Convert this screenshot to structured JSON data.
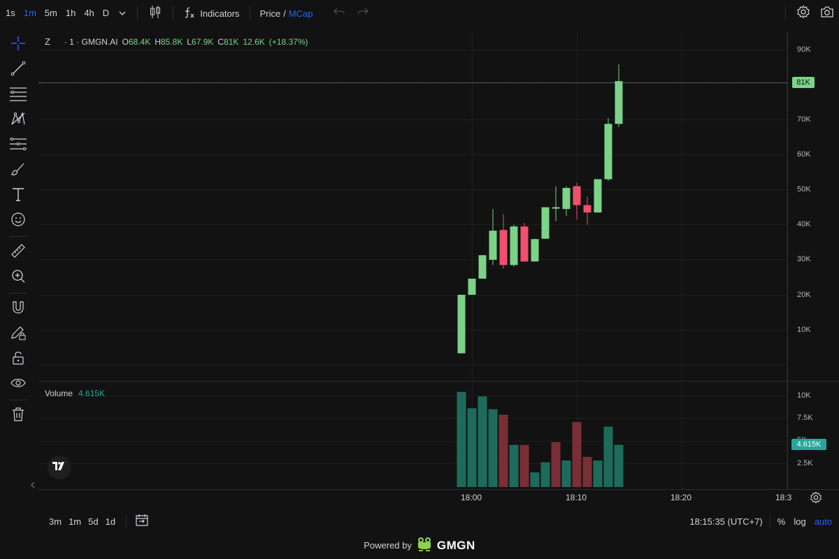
{
  "toolbar": {
    "timeframes": [
      "1s",
      "1m",
      "5m",
      "1h",
      "4h",
      "D"
    ],
    "active_timeframe": "1m",
    "indicators_label": "Indicators",
    "price_label": "Price",
    "price_sep": "/",
    "mcap_label": "MCap"
  },
  "legend": {
    "symbol": "Z",
    "interval": "· 1 · GMGN.AI",
    "open_label": "O",
    "open": "68.4K",
    "high_label": "H",
    "high": "85.8K",
    "low_label": "L",
    "low": "67.9K",
    "close_label": "C",
    "close": "81K",
    "change": "12.6K",
    "change_pct": "(+18.37%)"
  },
  "volume_legend": {
    "label": "Volume",
    "value": "4.615K"
  },
  "price_axis": [
    "90K",
    "70K",
    "60K",
    "50K",
    "40K",
    "30K",
    "20K",
    "10K"
  ],
  "last_price_tag": "81K",
  "volume_axis": [
    "10K",
    "7.5K",
    "5K",
    "2.5K"
  ],
  "last_volume_tag": "4.615K",
  "time_axis": [
    "18:00",
    "18:10",
    "18:20",
    "18:3"
  ],
  "bottom": {
    "ranges": [
      "3m",
      "1m",
      "5d",
      "1d"
    ],
    "clock": "18:15:35 (UTC+7)",
    "percent": "%",
    "log": "log",
    "auto": "auto"
  },
  "footer": {
    "powered_by": "Powered by",
    "brand": "GMGN"
  },
  "colors": {
    "up": "#7bd389",
    "down": "#f0506e",
    "vol_up": "#1e6b5c",
    "vol_down": "#7a2e36",
    "accent": "#2962ff"
  },
  "chart_data": {
    "type": "candlestick",
    "x": [
      "18:00",
      "18:01",
      "18:02",
      "18:03",
      "18:04",
      "18:05",
      "18:06",
      "18:07",
      "18:08",
      "18:09",
      "18:10",
      "18:11",
      "18:12",
      "18:13",
      "18:14",
      "18:15"
    ],
    "ohlc": [
      [
        3.3,
        20.0,
        3.3,
        20.0
      ],
      [
        20.0,
        24.6,
        20.0,
        24.6
      ],
      [
        24.6,
        31.3,
        24.6,
        31.3
      ],
      [
        30.0,
        44.5,
        28.5,
        38.3
      ],
      [
        38.5,
        43.0,
        27.5,
        28.5
      ],
      [
        28.5,
        40.0,
        28.0,
        39.5
      ],
      [
        39.5,
        40.5,
        30.0,
        29.5
      ],
      [
        29.5,
        36.0,
        29.5,
        35.9
      ],
      [
        36.0,
        45.0,
        36.0,
        45.0
      ],
      [
        45.0,
        51.0,
        41.0,
        44.8
      ],
      [
        44.5,
        51.0,
        42.5,
        50.5
      ],
      [
        51.0,
        52.0,
        41.5,
        45.6
      ],
      [
        45.6,
        48.0,
        40.0,
        43.5
      ],
      [
        43.5,
        53.0,
        43.5,
        53.0
      ],
      [
        53.0,
        70.5,
        52.5,
        68.8
      ],
      [
        68.8,
        85.8,
        67.9,
        81.0
      ]
    ],
    "candle_colors": [
      "up",
      "up",
      "up",
      "up",
      "down",
      "up",
      "down",
      "up",
      "up",
      "up",
      "up",
      "down",
      "down",
      "up",
      "up",
      "up"
    ],
    "volumes": [
      10.4,
      8.6,
      9.9,
      8.5,
      7.9,
      4.6,
      4.6,
      1.6,
      2.7,
      4.9,
      2.9,
      7.1,
      3.3,
      2.9,
      6.6,
      4.615
    ],
    "volume_colors": [
      "up",
      "up",
      "up",
      "up",
      "down",
      "up",
      "down",
      "up",
      "up",
      "down",
      "up",
      "down",
      "down",
      "up",
      "up",
      "up"
    ],
    "y_unit": "K",
    "ylim": [
      0,
      95
    ],
    "vol_ylim": [
      0,
      11
    ]
  }
}
